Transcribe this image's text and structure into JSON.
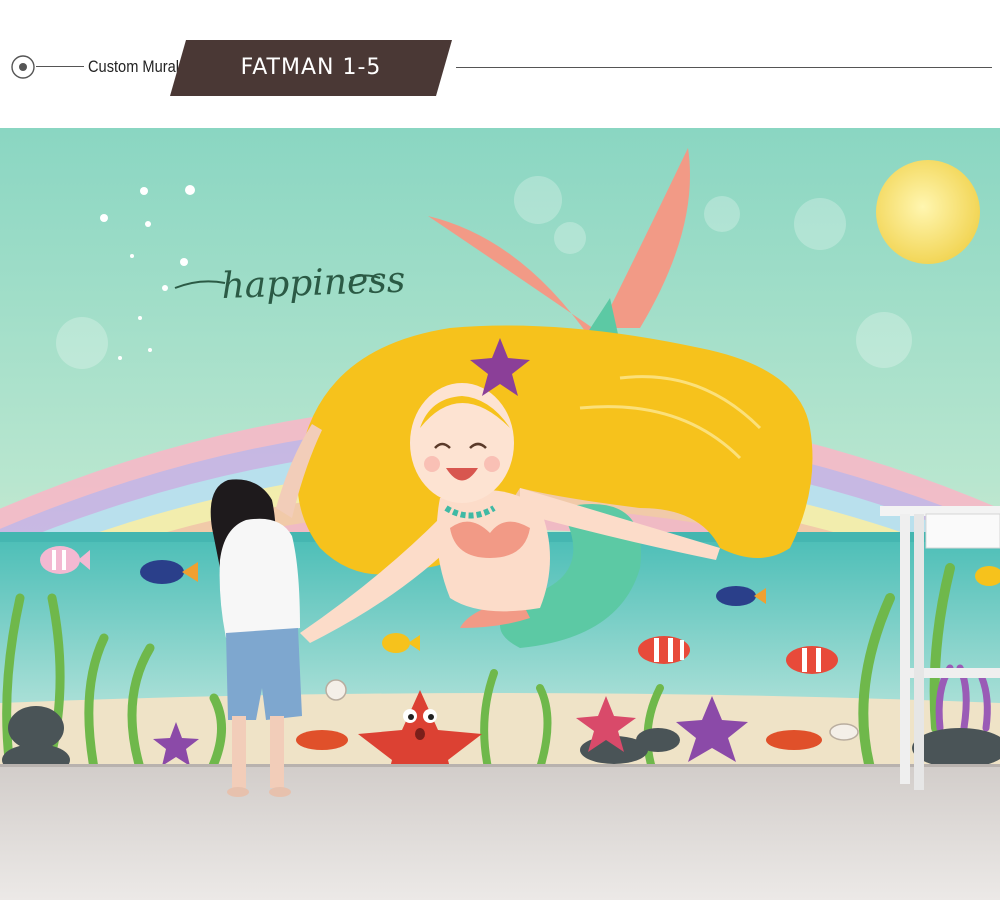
{
  "header": {
    "label": "Custom Mural",
    "title": "FATMAN 1-5",
    "banner_color": "#4a3835"
  },
  "mural": {
    "script_text": "happiness",
    "colors": {
      "sky_top": "#8fd8c0",
      "sea": "#5ec6bd",
      "floor": "#d9d5d3",
      "hair": "#f6c21c",
      "tail": "#5cc9a4",
      "fin": "#f29a86"
    }
  }
}
